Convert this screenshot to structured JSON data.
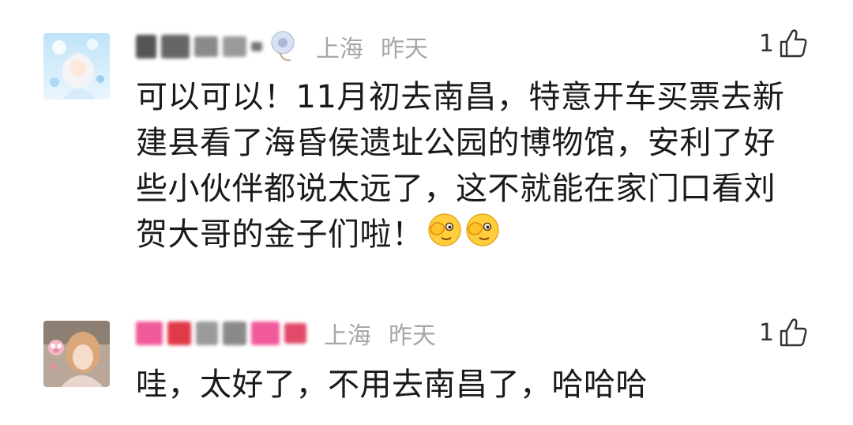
{
  "comments": [
    {
      "location": "上海",
      "time": "昨天",
      "likes": "1",
      "text": "可以可以！11月初去南昌，特意开车买票去新建县看了海昏侯遗址公园的博物馆，安利了好些小伙伴都说太远了，这不就能在家门口看刘贺大哥的金子们啦！",
      "emojis": [
        "covering-eye-emoji",
        "covering-eye-emoji"
      ]
    },
    {
      "location": "上海",
      "time": "昨天",
      "likes": "1",
      "text": "哇，太好了，不用去南昌了，哈哈哈"
    }
  ],
  "icons": {
    "like": "thumbs-up-outline-icon"
  },
  "colors": {
    "meta_text": "#a6a6a6",
    "body_text": "#1a1a1a",
    "like_text": "#333333"
  }
}
